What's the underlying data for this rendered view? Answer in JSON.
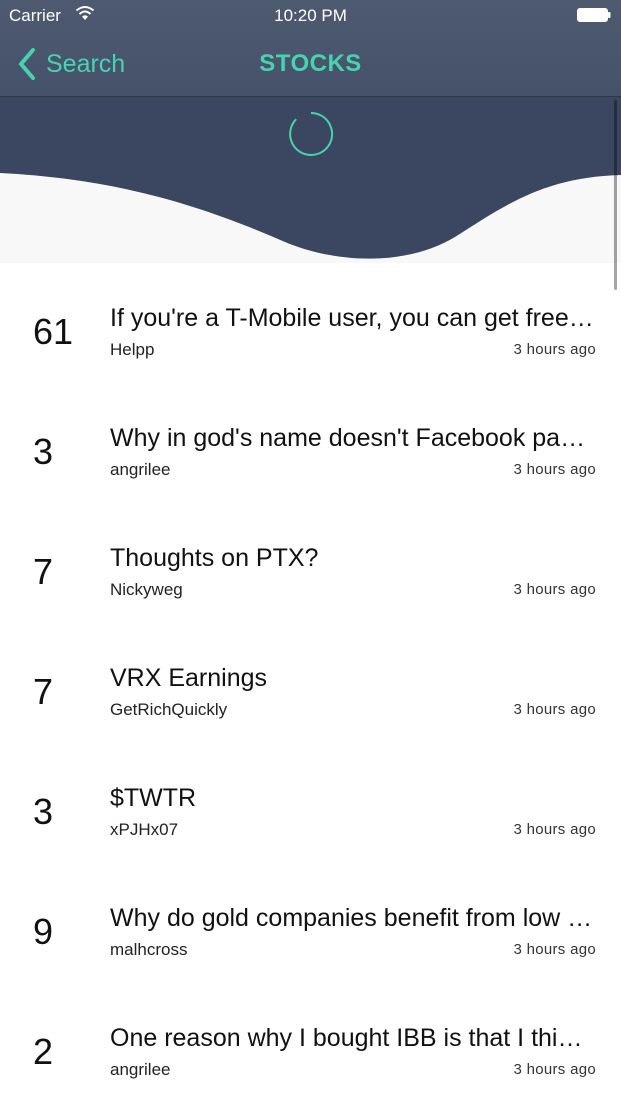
{
  "status_bar": {
    "carrier": "Carrier",
    "time": "10:20 PM",
    "wifi_icon": "wifi-icon",
    "battery_icon": "battery-icon"
  },
  "nav": {
    "back_label": "Search",
    "back_icon": "chevron-left-icon",
    "title": "STOCKS"
  },
  "colors": {
    "accent": "#46d3b0",
    "header": "#46526a",
    "wave": "#3b4760"
  },
  "posts": [
    {
      "score": "61",
      "title": "If you're a T-Mobile user, you can get free stock shares",
      "author": "Helpp",
      "time": "3 hours ago"
    },
    {
      "score": "3",
      "title": "Why in god's name doesn't Facebook pay a dividend?",
      "author": "angrilee",
      "time": "3 hours ago"
    },
    {
      "score": "7",
      "title": "Thoughts on PTX?",
      "author": "Nickyweg",
      "time": "3 hours ago"
    },
    {
      "score": "7",
      "title": "VRX Earnings",
      "author": "GetRichQuickly",
      "time": "3 hours ago"
    },
    {
      "score": "3",
      "title": "$TWTR",
      "author": "xPJHx07",
      "time": "3 hours ago"
    },
    {
      "score": "9",
      "title": "Why do gold companies benefit from low rates?",
      "author": "malhcross",
      "time": "3 hours ago"
    },
    {
      "score": "2",
      "title": "One reason why I bought IBB is that I think biotech will rebound",
      "author": "angrilee",
      "time": "3 hours ago"
    }
  ]
}
